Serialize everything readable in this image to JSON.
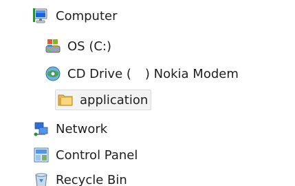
{
  "tree": {
    "items": [
      {
        "label": "Computer",
        "icon": "computer-icon"
      },
      {
        "label": "OS (C:)",
        "icon": "drive-icon"
      },
      {
        "label_prefix": "CD Drive (",
        "label_suffix": ") Nokia Modem",
        "icon": "cd-drive-icon"
      },
      {
        "label": "application",
        "icon": "folder-icon",
        "selected": true
      },
      {
        "label": "Network",
        "icon": "network-icon"
      },
      {
        "label": "Control Panel",
        "icon": "control-panel-icon"
      },
      {
        "label": "Recycle Bin",
        "icon": "recycle-bin-icon"
      }
    ]
  },
  "colors": {
    "text": "#1e1e1e",
    "selection_bg": "#f3f3f3",
    "selection_border": "#dadada"
  }
}
